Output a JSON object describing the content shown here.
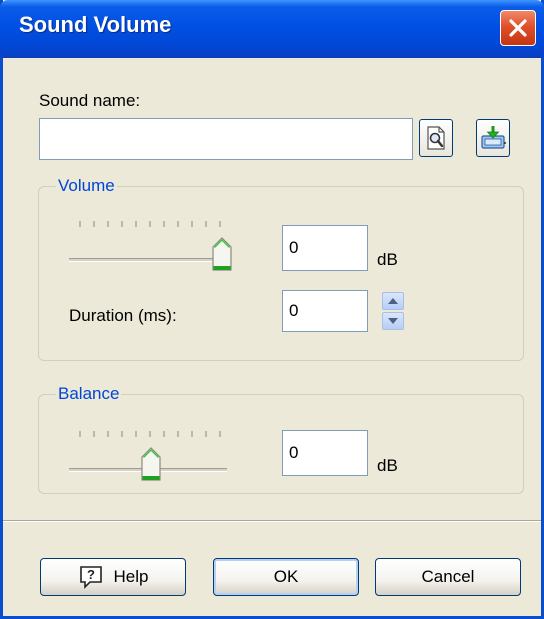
{
  "window": {
    "title": "Sound Volume",
    "close_icon": "close-x-icon"
  },
  "sound": {
    "label": "Sound name:",
    "value": "",
    "browse_icon": "magnifier-document-icon",
    "import_icon": "import-download-icon"
  },
  "volume_group": {
    "legend": "Volume",
    "slider_level": 1.0,
    "value": "0",
    "unit": "dB",
    "duration_label": "Duration (ms):",
    "duration_value": "0"
  },
  "balance_group": {
    "legend": "Balance",
    "slider_level": 0.5,
    "value": "0",
    "unit": "dB"
  },
  "buttons": {
    "help_label": "Help",
    "help_icon": "help-question-icon",
    "ok_label": "OK",
    "cancel_label": "Cancel"
  },
  "colors": {
    "titlebar": "#0a5ce8",
    "group_legend": "#0046d5",
    "close_button": "#e0502c",
    "thumb_accent": "#21a121"
  }
}
